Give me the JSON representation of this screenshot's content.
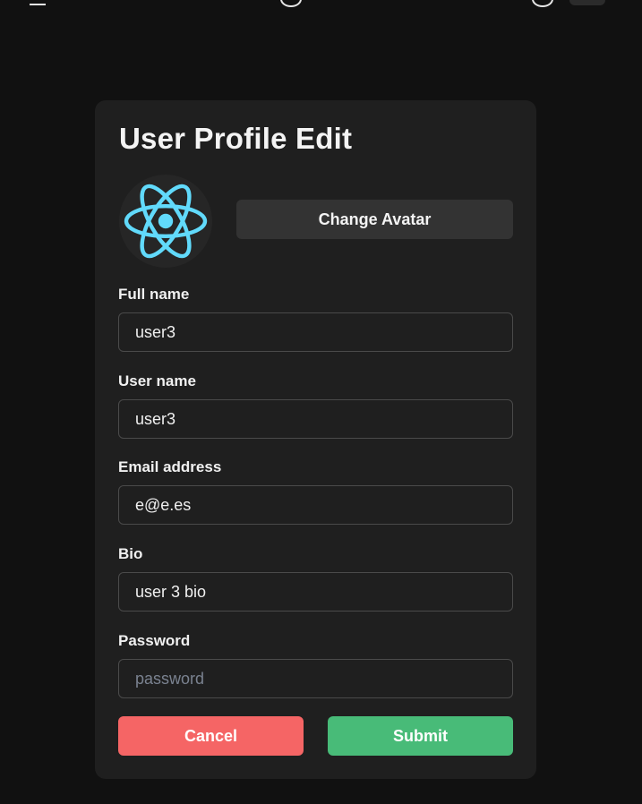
{
  "profile": {
    "title": "User Profile Edit",
    "change_avatar_label": "Change Avatar",
    "avatar_icon": "react-logo-icon",
    "fields": {
      "full_name": {
        "label": "Full name",
        "value": "user3"
      },
      "user_name": {
        "label": "User name",
        "value": "user3"
      },
      "email": {
        "label": "Email address",
        "value": "e@e.es"
      },
      "bio": {
        "label": "Bio",
        "value": "user 3 bio"
      },
      "password": {
        "label": "Password",
        "value": "",
        "placeholder": "password"
      }
    },
    "cancel_label": "Cancel",
    "submit_label": "Submit"
  },
  "colors": {
    "page_background": "#111111",
    "card_background": "#1f1f1f",
    "cancel": "#f56565",
    "submit": "#48bb78",
    "react_logo": "#61dafb"
  }
}
